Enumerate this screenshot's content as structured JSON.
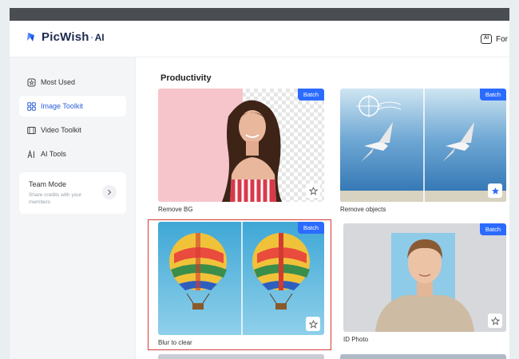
{
  "app": {
    "logo_text": "PicWish",
    "logo_dot": "·",
    "logo_suffix": "AI",
    "header_right_text": "For D"
  },
  "sidebar": {
    "items": [
      {
        "label": "Most Used",
        "icon": "star-outline-icon"
      },
      {
        "label": "Image Toolkit",
        "icon": "grid-icon"
      },
      {
        "label": "Video Toolkit",
        "icon": "film-icon"
      },
      {
        "label": "AI Tools",
        "icon": "ai-icon"
      }
    ],
    "active_index": 1,
    "team": {
      "title": "Team Mode",
      "description": "Share credits with your members"
    }
  },
  "main": {
    "section_title": "Productivity",
    "badge_label": "Batch",
    "cards": [
      {
        "label": "Remove BG",
        "favorited": false
      },
      {
        "label": "Remove objects",
        "favorited": true
      },
      {
        "label": "Blur to clear",
        "favorited": false,
        "highlighted": true
      },
      {
        "label": "ID Photo",
        "favorited": false
      }
    ]
  },
  "colors": {
    "accent": "#2b6bff",
    "highlight": "#d93a3a",
    "sidebar_bg": "#f4f5f7"
  }
}
